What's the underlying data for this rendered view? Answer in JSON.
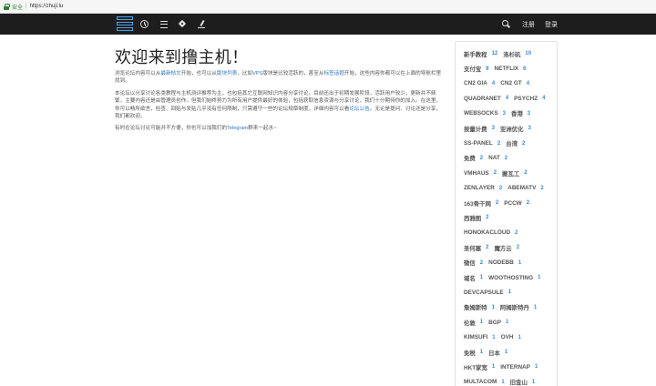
{
  "browser": {
    "secure_label": "安全",
    "url": "https://zhuji.lu"
  },
  "nav": {
    "logo": "bars-logo",
    "icons": [
      "clock-icon",
      "list-icon",
      "tags-icon",
      "pen-icon",
      "search-icon"
    ],
    "register": "注册",
    "login": "登录"
  },
  "main": {
    "title": "欢迎来到撸主机！",
    "p1": {
      "t1": "浏览论坛内容可以从",
      "link_latest": "最新帖文",
      "t2": "开始，也可以从",
      "link_boards": "版块列表",
      "t3": "，比如",
      "t3b": "VPS",
      "t3c": "版块是比较活跃的，甚至从",
      "link_tags": "标签话题",
      "t4": "开始，这些内容你都可以在上面的导航栏里找到。"
    },
    "p2": {
      "t1": "本论坛以分享讨论各类教程与主机测评推荐为主，也包括其它互联网知识内容分享讨论。目前还出于初期发展阶段，活跃用户较少，更新并不频繁，主要内容还是由管理员创作。但我们始终努力为所有用户提供最好的体验，包括获取信息资源与分享讨论，我们十分期待你的加入。在这里，你可以畅所欲言，检查、回贴与发贴几乎没有任何限制，只需遵守一些的论坛规章制度，详细内容可以看",
      "link_notice": "论坛公告",
      "t2": "。无论是提问、讨论还是分享，我们都欢迎。"
    },
    "p3": {
      "t1": "有时在论坛讨论可能并不方便，你也可以加我们的",
      "link_tg": "Telegram",
      "t2": "群来一起水~"
    }
  },
  "sidebar": {
    "rows": [
      [
        {
          "name": "新手教程",
          "count": "12"
        },
        {
          "name": "洛杉矶",
          "count": "10"
        }
      ],
      [
        {
          "name": "支付宝",
          "count": "9"
        },
        {
          "name": "NETFLIX",
          "count": "6"
        }
      ],
      [
        {
          "name": "CN2 GIA",
          "count": "4"
        },
        {
          "name": "CN2 GT",
          "count": "4"
        }
      ],
      [
        {
          "name": "QUADRANET",
          "count": "4"
        },
        {
          "name": "PSYCHZ",
          "count": "4"
        }
      ],
      [
        {
          "name": "WEBSOCKS",
          "count": "3"
        },
        {
          "name": "香港",
          "count": "3"
        }
      ],
      [
        {
          "name": "按量计费",
          "count": "3"
        },
        {
          "name": "亚洲优化",
          "count": "3"
        }
      ],
      [
        {
          "name": "SS-PANEL",
          "count": "2"
        },
        {
          "name": "台湾",
          "count": "2"
        }
      ],
      [
        {
          "name": "免费",
          "count": "2"
        },
        {
          "name": "NAT",
          "count": "2"
        }
      ],
      [
        {
          "name": "VMHAUS",
          "count": "2"
        },
        {
          "name": "搬瓦工",
          "count": "2"
        }
      ],
      [
        {
          "name": "ZENLAYER",
          "count": "2"
        },
        {
          "name": "ABEMATV",
          "count": "2"
        }
      ],
      [
        {
          "name": "163骨干网",
          "count": "2"
        },
        {
          "name": "PCCW",
          "count": "2"
        }
      ],
      [
        {
          "name": "西雅图",
          "count": "2"
        }
      ],
      [
        {
          "name": "HONOKACLOUD",
          "count": "2"
        }
      ],
      [
        {
          "name": "圣何塞",
          "count": "2"
        },
        {
          "name": "魔方云",
          "count": "2"
        }
      ],
      [
        {
          "name": "微信",
          "count": "2"
        },
        {
          "name": "NODEBB",
          "count": "1"
        }
      ],
      [
        {
          "name": "域名",
          "count": "1"
        },
        {
          "name": "WOOTHOSTING",
          "count": "1"
        }
      ],
      [
        {
          "name": "DEVCAPSULE",
          "count": "1"
        }
      ],
      [
        {
          "name": "詹姆斯特",
          "count": "1"
        },
        {
          "name": "阿姆斯特丹",
          "count": "1"
        }
      ],
      [
        {
          "name": "伦敦",
          "count": "1"
        },
        {
          "name": "BGP",
          "count": "1"
        }
      ],
      [
        {
          "name": "KIMSUFI",
          "count": "1"
        },
        {
          "name": "OVH",
          "count": "1"
        }
      ],
      [
        {
          "name": "免税",
          "count": "1"
        },
        {
          "name": "日本",
          "count": "1"
        }
      ],
      [
        {
          "name": "HKT家宽",
          "count": "1"
        },
        {
          "name": "INTERNAP",
          "count": "1"
        }
      ],
      [
        {
          "name": "MULTACOM",
          "count": "1"
        },
        {
          "name": "旧金山",
          "count": "1"
        }
      ]
    ]
  },
  "colors": {
    "navbar": "#1d1d1d",
    "link": "#2a75c6",
    "count": "#3a8ad6",
    "secure": "#2e7d32"
  }
}
